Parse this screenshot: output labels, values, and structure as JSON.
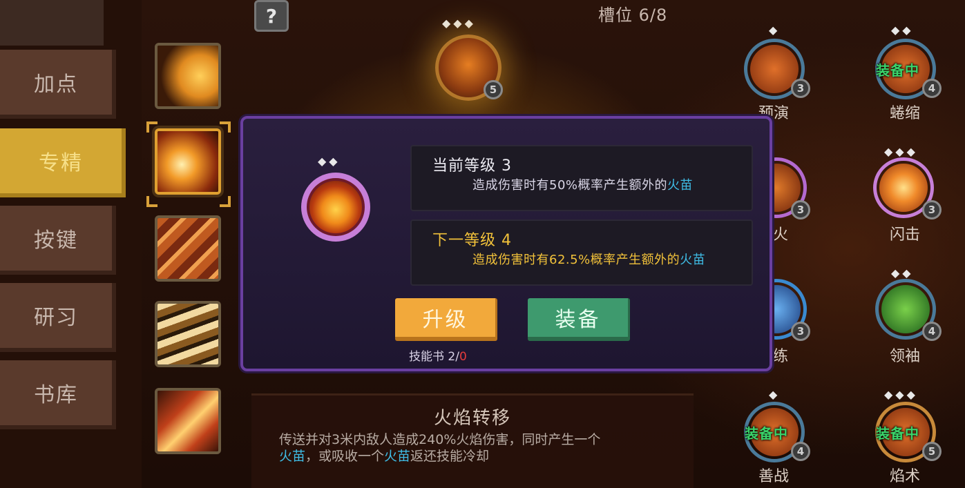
{
  "header": {
    "slot_label": "槽位 6/8",
    "help_label": "?"
  },
  "menu": {
    "items": [
      {
        "label": "加点"
      },
      {
        "label": "专精",
        "active": true
      },
      {
        "label": "按键"
      },
      {
        "label": "研习"
      },
      {
        "label": "书库"
      }
    ]
  },
  "top_skill": {
    "level": "5"
  },
  "nodes": [
    {
      "label": "预演",
      "level": "3",
      "equipped": ""
    },
    {
      "label": "蜷缩",
      "level": "4",
      "equipped": "装备中"
    },
    {
      "label": "火",
      "level": "3",
      "equipped": ""
    },
    {
      "label": "闪击",
      "level": "3",
      "equipped": ""
    },
    {
      "label": "练",
      "level": "3",
      "equipped": ""
    },
    {
      "label": "领袖",
      "level": "4",
      "equipped": ""
    },
    {
      "label": "善战",
      "level": "4",
      "equipped": "装备中"
    },
    {
      "label": "焰术",
      "level": "5",
      "equipped": "装备中"
    }
  ],
  "description": {
    "title": "火焰转移",
    "line1": "传送并对3米内敌人造成240%火焰伤害，同时产生一个",
    "line2_cyan1": "火苗",
    "line2_mid": "，或吸收一个",
    "line2_cyan2": "火苗",
    "line2_end": "返还技能冷却"
  },
  "modal": {
    "current": {
      "title": "当前等级 3",
      "desc_prefix": "造成伤害时有50%概率产生额外的",
      "desc_highlight": "火苗"
    },
    "next": {
      "title": "下一等级 4",
      "desc_prefix": "造成伤害时有62.5%概率产生额外的",
      "desc_highlight": "火苗"
    },
    "upgrade_label": "升级",
    "equip_label": "装备",
    "book_prefix": "技能书 2/",
    "book_have": "0"
  },
  "colors": {
    "active_menu": "#d3a733",
    "upgrade": "#f2a93b",
    "equip": "#3e9a6e",
    "highlight_cyan": "#3fbde6",
    "next_level_yellow": "#f2c23a",
    "equipped_green": "#3ad36a"
  }
}
